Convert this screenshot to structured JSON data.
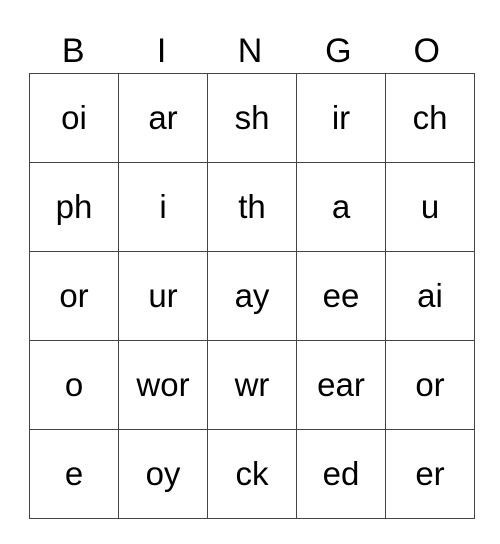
{
  "header": [
    "B",
    "I",
    "N",
    "G",
    "O"
  ],
  "rows": [
    [
      "oi",
      "ar",
      "sh",
      "ir",
      "ch"
    ],
    [
      "ph",
      "i",
      "th",
      "a",
      "u"
    ],
    [
      "or",
      "ur",
      "ay",
      "ee",
      "ai"
    ],
    [
      "o",
      "wor",
      "wr",
      "ear",
      "or"
    ],
    [
      "e",
      "oy",
      "ck",
      "ed",
      "er"
    ]
  ]
}
